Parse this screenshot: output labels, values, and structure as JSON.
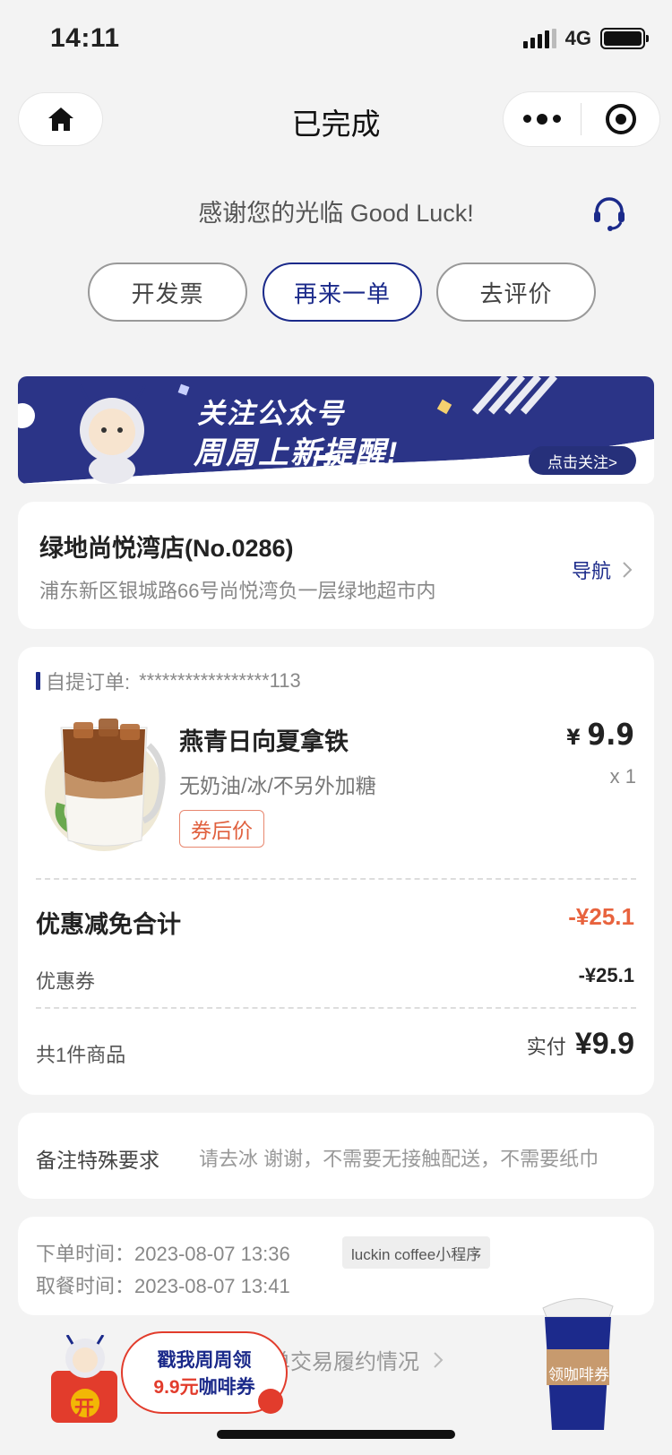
{
  "status_bar": {
    "time": "14:11",
    "network": "4G"
  },
  "header": {
    "title": "已完成"
  },
  "thanks": "感谢您的光临 Good Luck!",
  "actions": {
    "invoice": "开发票",
    "reorder": "再来一单",
    "review": "去评价"
  },
  "banner": {
    "line1": "关注公众号",
    "line2": "周周上新提醒!",
    "follow": "点击关注>"
  },
  "store": {
    "name": "绿地尚悦湾店(No.0286)",
    "address": "浦东新区银城路66号尚悦湾负一层绿地超市内",
    "nav_label": "导航"
  },
  "order": {
    "label": "自提订单:",
    "number": "*****************113",
    "item": {
      "name": "燕青日向夏拿铁",
      "spec": "无奶油/冰/不另外加糖",
      "tag": "券后价",
      "currency": "¥",
      "price": "9.9",
      "qty": "x 1"
    },
    "discount_title": "优惠减免合计",
    "discount_total": "-¥25.1",
    "coupon_label": "优惠券",
    "coupon_value": "-¥25.1",
    "count_label": "共1件商品",
    "paid_label": "实付",
    "paid_amount": "¥9.9"
  },
  "remark": {
    "label": "备注特殊要求",
    "text": "请去冰 谢谢，不需要无接触配送，不需要纸巾"
  },
  "times": {
    "order_time": "下单时间：2023-08-07 13:36",
    "source": "luckin coffee小程序",
    "pickup_time": "取餐时间：2023-08-07 13:41"
  },
  "history_link": "单交易履约情况",
  "promo": {
    "line1": "戳我周周领",
    "price": "9.9元",
    "line2_rest": "咖啡券",
    "redpack_char": "开",
    "cup_label": "领咖啡券"
  },
  "colors": {
    "brand_blue": "#1b2a8a",
    "accent_red": "#e8633e",
    "background": "#f3f3f3"
  }
}
